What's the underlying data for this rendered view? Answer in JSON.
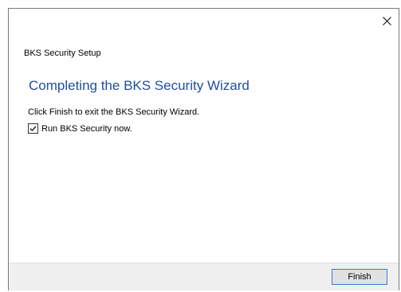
{
  "window": {
    "app_title": "BKS Security Setup",
    "heading": "Completing the BKS Security Wizard",
    "description": "Click Finish to exit the BKS Security Wizard.",
    "run_checkbox": {
      "label": "Run BKS Security now.",
      "checked": true
    },
    "finish_label": "Finish",
    "close_icon": "close-icon"
  },
  "colors": {
    "heading": "#1f4e9c",
    "footer_bg": "#f0f0f0",
    "button_border": "#3c78d8"
  }
}
